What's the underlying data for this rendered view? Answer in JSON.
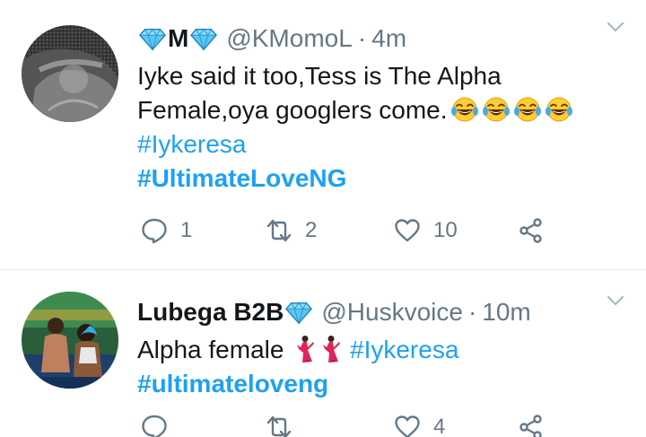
{
  "tweets": [
    {
      "name": "M",
      "handle": "@KMomoL",
      "time": "4m",
      "text": "Iyke said it too,Tess is The Alpha Female,oya googlers come.",
      "tags": [
        "#Iykeresa",
        "#UltimateLoveNG"
      ],
      "reply_count": "1",
      "retweet_count": "2",
      "like_count": "10"
    },
    {
      "name": "Lubega B2B",
      "handle": "@Huskvoice",
      "time": "10m",
      "text": "Alpha female",
      "tags": [
        "#Iykeresa",
        "#ultimateloveng"
      ],
      "reply_count": "",
      "retweet_count": "",
      "like_count": "4"
    }
  ],
  "separator": "·",
  "colors": {
    "link": "#1da1f2",
    "muted": "#657786",
    "divider": "#e6ecf0"
  }
}
